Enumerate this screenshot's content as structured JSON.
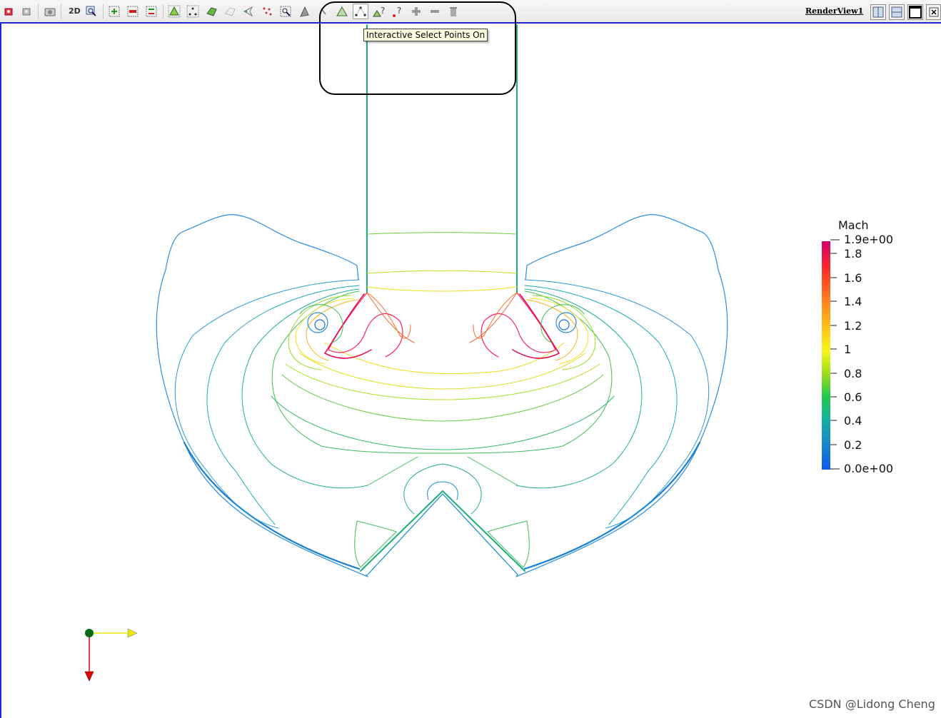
{
  "toolbar": {
    "mode_2d_label": "2D",
    "render_view_title": "RenderView1",
    "tooltip": "Interactive Select Points On",
    "icons": [
      "reset-camera-icon",
      "zoom-to-data-icon",
      "capture-screenshot-icon",
      "zoom-to-box-icon",
      "add-selection-icon",
      "remove-selection-icon",
      "toggle-selection-icon",
      "select-cells-on-icon",
      "select-points-on-icon",
      "select-cells-frustum-icon",
      "select-points-frustum-icon",
      "select-block-icon",
      "select-cells-polygon-icon",
      "select-points-polygon-icon",
      "interactive-select-cells-icon",
      "interactive-select-points-icon",
      "hover-points-icon",
      "hover-cells-icon",
      "grow-selection-icon",
      "shrink-selection-icon",
      "clear-selection-icon",
      "split-horizontal-icon",
      "split-vertical-icon",
      "maximize-icon",
      "close-icon"
    ]
  },
  "colorbar": {
    "title": "Mach",
    "ticks": [
      "1.9e+00",
      "1.8",
      "1.6",
      "1.4",
      "1.2",
      "1",
      "0.8",
      "0.6",
      "0.4",
      "0.2",
      "0.0e+00"
    ],
    "colors": [
      "#ff0059",
      "#ff2a2a",
      "#ff7c1e",
      "#ffc21a",
      "#f6f61a",
      "#9edd1a",
      "#22c94c",
      "#14b0a0",
      "#1989c9",
      "#0f5ae8"
    ]
  },
  "axes": {
    "x_color": "#e8e800",
    "y_color": "#dd0000",
    "origin_color": "#007a1a"
  },
  "watermark": "CSDN @Lidong Cheng"
}
